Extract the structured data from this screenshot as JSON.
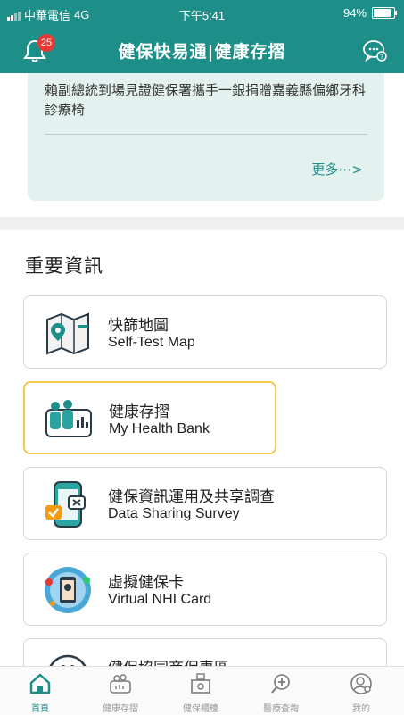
{
  "status_bar": {
    "carrier": "中華電信",
    "network": "4G",
    "time": "下午5:41",
    "battery": "94%"
  },
  "header": {
    "title": "健保快易通|健康存摺",
    "notification_count": "25"
  },
  "news": {
    "headline": "賴副總統到場見證健保署攜手一銀捐贈嘉義縣偏鄉牙科診療椅",
    "more_label": "更多⋯>"
  },
  "important": {
    "title": "重要資訊",
    "items": [
      {
        "zh": "快篩地圖",
        "en": "Self-Test Map",
        "icon": "map-icon"
      },
      {
        "zh": "健康存摺",
        "en": "My Health Bank",
        "icon": "health-bank-icon"
      },
      {
        "zh": "健保資訊運用及共享調查",
        "en": "Data Sharing Survey",
        "icon": "survey-phone-icon"
      },
      {
        "zh": "虛擬健保卡",
        "en": "Virtual NHI Card",
        "icon": "virtual-card-icon"
      },
      {
        "zh": "健保協同商保專區",
        "en": "",
        "icon": "cooperation-icon"
      }
    ]
  },
  "tabs": [
    {
      "label": "首頁",
      "icon": "home-icon",
      "active": true
    },
    {
      "label": "健康存摺",
      "icon": "health-bank-tab-icon",
      "active": false
    },
    {
      "label": "健保櫃檯",
      "icon": "counter-icon",
      "active": false
    },
    {
      "label": "醫療查詢",
      "icon": "medical-search-icon",
      "active": false
    },
    {
      "label": "我的",
      "icon": "profile-icon",
      "active": false
    }
  ],
  "colors": {
    "brand": "#1e8e89",
    "news_bg": "#e4f2ef",
    "highlight": "#f2c94c",
    "badge": "#e53935"
  }
}
